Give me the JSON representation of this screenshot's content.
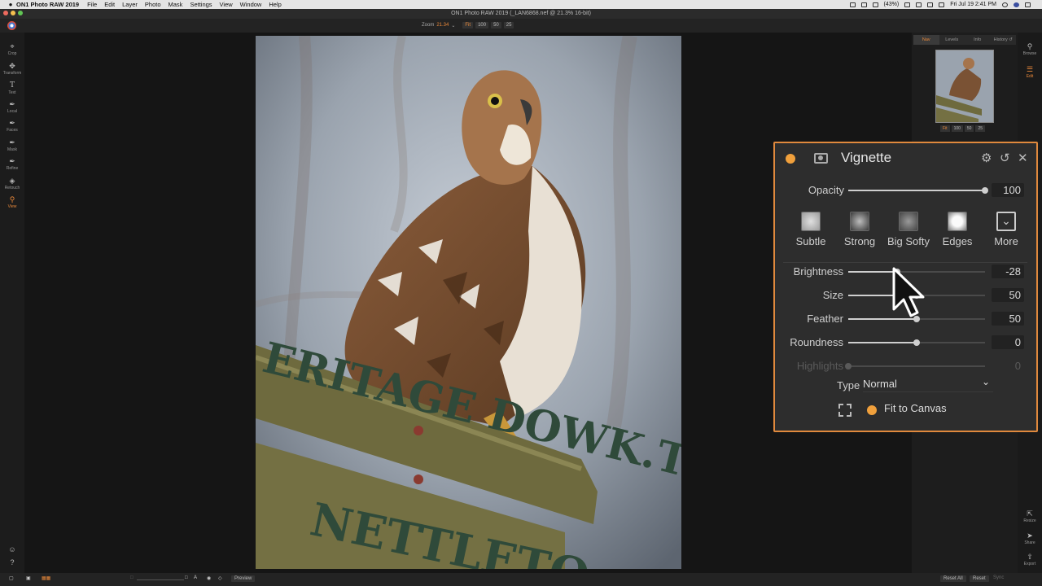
{
  "menubar": {
    "app_name": "ON1 Photo RAW 2019",
    "items": [
      "File",
      "Edit",
      "Layer",
      "Photo",
      "Mask",
      "Settings",
      "View",
      "Window",
      "Help"
    ],
    "battery": "(43%)",
    "clock": "Fri Jul 19  2:41 PM"
  },
  "window": {
    "title": "ON1 Photo RAW 2019 (_LAN6868.nef @ 21.3% 16-bit)"
  },
  "toolbar": {
    "zoom_label": "Zoom",
    "zoom_value": "21.34",
    "zoom_buttons": [
      "Fit",
      "100",
      "50",
      "25"
    ]
  },
  "left_tools": [
    "Crop",
    "Transform",
    "Text",
    "Local",
    "Faces",
    "Mask",
    "Refine",
    "Retouch",
    "View"
  ],
  "nav": {
    "tabs": [
      "Nav",
      "Levels",
      "Info",
      "History"
    ],
    "zoom_buttons": [
      "Fit",
      "100",
      "50",
      "25"
    ]
  },
  "modules": {
    "top": [
      "Browse",
      "Edit"
    ],
    "bottom": [
      "Resize",
      "Share",
      "Export"
    ]
  },
  "vignette": {
    "title": "Vignette",
    "opacity_label": "Opacity",
    "opacity_value": "100",
    "opacity_level": 1.0,
    "presets": [
      "Subtle",
      "Strong",
      "Big Softy",
      "Edges",
      "More"
    ],
    "sliders": [
      {
        "label": "Brightness",
        "value": "-28",
        "level": 0.36
      },
      {
        "label": "Size",
        "value": "50",
        "level": 0.5
      },
      {
        "label": "Feather",
        "value": "50",
        "level": 0.5
      },
      {
        "label": "Roundness",
        "value": "0",
        "level": 0.5
      },
      {
        "label": "Highlights",
        "value": "0",
        "level": 0.0
      }
    ],
    "type_label": "Type",
    "type_value": "Normal",
    "fit_label": "Fit to Canvas"
  },
  "bottombar": {
    "preview": "Preview",
    "reset_all": "Reset All",
    "reset": "Reset",
    "sync": "Sync"
  },
  "colors": {
    "accent": "#e8883a",
    "panel_border": "#e0893d",
    "panel_bg": "#2d2d2d"
  }
}
